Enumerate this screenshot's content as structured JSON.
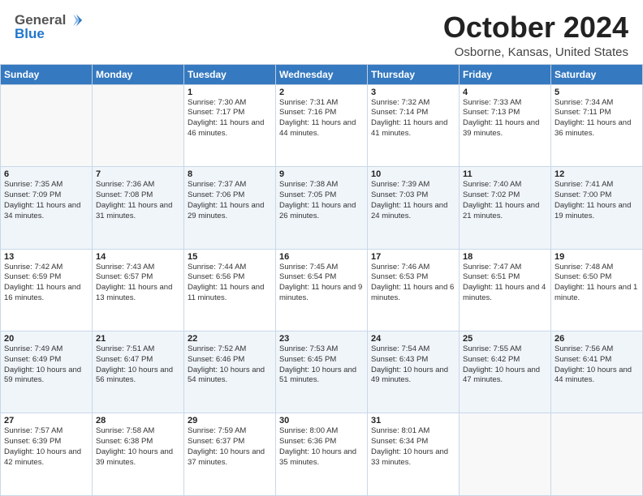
{
  "header": {
    "logo_general": "General",
    "logo_blue": "Blue",
    "month_title": "October 2024",
    "location": "Osborne, Kansas, United States"
  },
  "weekdays": [
    "Sunday",
    "Monday",
    "Tuesday",
    "Wednesday",
    "Thursday",
    "Friday",
    "Saturday"
  ],
  "weeks": [
    [
      {
        "day": "",
        "sunrise": "",
        "sunset": "",
        "daylight": ""
      },
      {
        "day": "",
        "sunrise": "",
        "sunset": "",
        "daylight": ""
      },
      {
        "day": "1",
        "sunrise": "Sunrise: 7:30 AM",
        "sunset": "Sunset: 7:17 PM",
        "daylight": "Daylight: 11 hours and 46 minutes."
      },
      {
        "day": "2",
        "sunrise": "Sunrise: 7:31 AM",
        "sunset": "Sunset: 7:16 PM",
        "daylight": "Daylight: 11 hours and 44 minutes."
      },
      {
        "day": "3",
        "sunrise": "Sunrise: 7:32 AM",
        "sunset": "Sunset: 7:14 PM",
        "daylight": "Daylight: 11 hours and 41 minutes."
      },
      {
        "day": "4",
        "sunrise": "Sunrise: 7:33 AM",
        "sunset": "Sunset: 7:13 PM",
        "daylight": "Daylight: 11 hours and 39 minutes."
      },
      {
        "day": "5",
        "sunrise": "Sunrise: 7:34 AM",
        "sunset": "Sunset: 7:11 PM",
        "daylight": "Daylight: 11 hours and 36 minutes."
      }
    ],
    [
      {
        "day": "6",
        "sunrise": "Sunrise: 7:35 AM",
        "sunset": "Sunset: 7:09 PM",
        "daylight": "Daylight: 11 hours and 34 minutes."
      },
      {
        "day": "7",
        "sunrise": "Sunrise: 7:36 AM",
        "sunset": "Sunset: 7:08 PM",
        "daylight": "Daylight: 11 hours and 31 minutes."
      },
      {
        "day": "8",
        "sunrise": "Sunrise: 7:37 AM",
        "sunset": "Sunset: 7:06 PM",
        "daylight": "Daylight: 11 hours and 29 minutes."
      },
      {
        "day": "9",
        "sunrise": "Sunrise: 7:38 AM",
        "sunset": "Sunset: 7:05 PM",
        "daylight": "Daylight: 11 hours and 26 minutes."
      },
      {
        "day": "10",
        "sunrise": "Sunrise: 7:39 AM",
        "sunset": "Sunset: 7:03 PM",
        "daylight": "Daylight: 11 hours and 24 minutes."
      },
      {
        "day": "11",
        "sunrise": "Sunrise: 7:40 AM",
        "sunset": "Sunset: 7:02 PM",
        "daylight": "Daylight: 11 hours and 21 minutes."
      },
      {
        "day": "12",
        "sunrise": "Sunrise: 7:41 AM",
        "sunset": "Sunset: 7:00 PM",
        "daylight": "Daylight: 11 hours and 19 minutes."
      }
    ],
    [
      {
        "day": "13",
        "sunrise": "Sunrise: 7:42 AM",
        "sunset": "Sunset: 6:59 PM",
        "daylight": "Daylight: 11 hours and 16 minutes."
      },
      {
        "day": "14",
        "sunrise": "Sunrise: 7:43 AM",
        "sunset": "Sunset: 6:57 PM",
        "daylight": "Daylight: 11 hours and 13 minutes."
      },
      {
        "day": "15",
        "sunrise": "Sunrise: 7:44 AM",
        "sunset": "Sunset: 6:56 PM",
        "daylight": "Daylight: 11 hours and 11 minutes."
      },
      {
        "day": "16",
        "sunrise": "Sunrise: 7:45 AM",
        "sunset": "Sunset: 6:54 PM",
        "daylight": "Daylight: 11 hours and 9 minutes."
      },
      {
        "day": "17",
        "sunrise": "Sunrise: 7:46 AM",
        "sunset": "Sunset: 6:53 PM",
        "daylight": "Daylight: 11 hours and 6 minutes."
      },
      {
        "day": "18",
        "sunrise": "Sunrise: 7:47 AM",
        "sunset": "Sunset: 6:51 PM",
        "daylight": "Daylight: 11 hours and 4 minutes."
      },
      {
        "day": "19",
        "sunrise": "Sunrise: 7:48 AM",
        "sunset": "Sunset: 6:50 PM",
        "daylight": "Daylight: 11 hours and 1 minute."
      }
    ],
    [
      {
        "day": "20",
        "sunrise": "Sunrise: 7:49 AM",
        "sunset": "Sunset: 6:49 PM",
        "daylight": "Daylight: 10 hours and 59 minutes."
      },
      {
        "day": "21",
        "sunrise": "Sunrise: 7:51 AM",
        "sunset": "Sunset: 6:47 PM",
        "daylight": "Daylight: 10 hours and 56 minutes."
      },
      {
        "day": "22",
        "sunrise": "Sunrise: 7:52 AM",
        "sunset": "Sunset: 6:46 PM",
        "daylight": "Daylight: 10 hours and 54 minutes."
      },
      {
        "day": "23",
        "sunrise": "Sunrise: 7:53 AM",
        "sunset": "Sunset: 6:45 PM",
        "daylight": "Daylight: 10 hours and 51 minutes."
      },
      {
        "day": "24",
        "sunrise": "Sunrise: 7:54 AM",
        "sunset": "Sunset: 6:43 PM",
        "daylight": "Daylight: 10 hours and 49 minutes."
      },
      {
        "day": "25",
        "sunrise": "Sunrise: 7:55 AM",
        "sunset": "Sunset: 6:42 PM",
        "daylight": "Daylight: 10 hours and 47 minutes."
      },
      {
        "day": "26",
        "sunrise": "Sunrise: 7:56 AM",
        "sunset": "Sunset: 6:41 PM",
        "daylight": "Daylight: 10 hours and 44 minutes."
      }
    ],
    [
      {
        "day": "27",
        "sunrise": "Sunrise: 7:57 AM",
        "sunset": "Sunset: 6:39 PM",
        "daylight": "Daylight: 10 hours and 42 minutes."
      },
      {
        "day": "28",
        "sunrise": "Sunrise: 7:58 AM",
        "sunset": "Sunset: 6:38 PM",
        "daylight": "Daylight: 10 hours and 39 minutes."
      },
      {
        "day": "29",
        "sunrise": "Sunrise: 7:59 AM",
        "sunset": "Sunset: 6:37 PM",
        "daylight": "Daylight: 10 hours and 37 minutes."
      },
      {
        "day": "30",
        "sunrise": "Sunrise: 8:00 AM",
        "sunset": "Sunset: 6:36 PM",
        "daylight": "Daylight: 10 hours and 35 minutes."
      },
      {
        "day": "31",
        "sunrise": "Sunrise: 8:01 AM",
        "sunset": "Sunset: 6:34 PM",
        "daylight": "Daylight: 10 hours and 33 minutes."
      },
      {
        "day": "",
        "sunrise": "",
        "sunset": "",
        "daylight": ""
      },
      {
        "day": "",
        "sunrise": "",
        "sunset": "",
        "daylight": ""
      }
    ]
  ]
}
